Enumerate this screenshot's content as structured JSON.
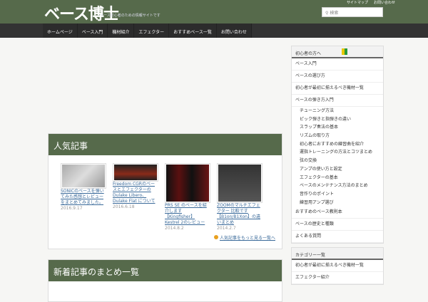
{
  "header": {
    "logo": "ベース博士",
    "tagline": "ベース初心者のための情報サイトです",
    "links": [
      "サイトマップ",
      "お問い合わせ"
    ],
    "search_placeholder": "検索"
  },
  "nav": [
    "ホームページ",
    "ベース入門",
    "機材紹介",
    "エフェクター",
    "おすすめベース一覧",
    "お問い合わせ"
  ],
  "popular": {
    "title": "人気記事",
    "items": [
      {
        "title": "SONICのベースを弾いてみた感想とレビューをまとめてみました。",
        "date": "2016.9.17"
      },
      {
        "title": "Freedom CGRのベースとエフェクターの Dulake Libero、Dulake Flat について",
        "date": "2016.6.18"
      },
      {
        "title": "PRS SE のベースを紹介します【Kingfisher】 Kestrel 2のレビュー",
        "date": "2014.8.2"
      },
      {
        "title": "ZOOMのマルチエフェクター 比較です 【B1on/B1Xon】の違いまとめ",
        "date": "2014.2.7"
      }
    ],
    "more": "人気記事をもっと見る一覧へ"
  },
  "section2": {
    "title": "新着記事のまとめ一覧"
  },
  "sidebar": {
    "title": "初心者の方へ",
    "items": [
      {
        "label": "ベース入門",
        "sub": false
      },
      {
        "label": "ベースの選び方",
        "sub": false
      },
      {
        "label": "初心者が最初に揃えるべき機材一覧",
        "sub": false
      },
      {
        "label": "ベースの弾き方入門",
        "sub": false
      },
      {
        "label": "チューニング方法",
        "sub": true
      },
      {
        "label": "ピック弾きと指弾きの違い",
        "sub": true
      },
      {
        "label": "スラップ奏法の基本",
        "sub": true
      },
      {
        "label": "リズムの取り方",
        "sub": true
      },
      {
        "label": "初心者におすすめの練習曲を紹介",
        "sub": true
      },
      {
        "label": "運指トレーニングの方法とコツまとめ",
        "sub": true
      },
      {
        "label": "弦の交換",
        "sub": true
      },
      {
        "label": "アンプの使い方と設定",
        "sub": true
      },
      {
        "label": "エフェクターの基本",
        "sub": true
      },
      {
        "label": "ベースのメンテナンス方法のまとめ",
        "sub": true
      },
      {
        "label": "音作りのポイント",
        "sub": true
      },
      {
        "label": "練習用アンプ選び",
        "sub": true
      },
      {
        "label": "おすすめのベース教則本",
        "sub": false
      },
      {
        "label": "ベースの歴史と種類",
        "sub": false
      },
      {
        "label": "よくある質問",
        "sub": false
      }
    ]
  },
  "sidebar2": {
    "title": "カテゴリー一覧",
    "items": [
      "初心者が最初に揃えるべき機材一覧",
      "エフェクター紹介"
    ]
  }
}
